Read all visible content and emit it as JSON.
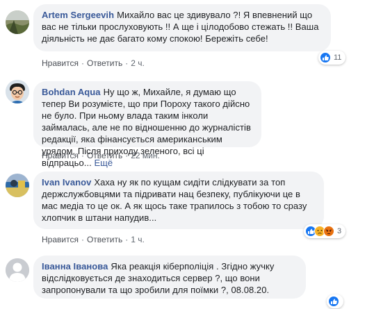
{
  "comments": [
    {
      "author": "Artem Sergeevih",
      "text": "Михайло вас це здивувало ?! Я впевнений що вас не тільки прослуховують !! А ще і цілодобово стежать !! Ваша діяльність не дає багато кому спокою! Бережіть себе!",
      "reaction_count": "11",
      "reactions": [
        "like-icon"
      ],
      "like_label": "Нравится",
      "reply_label": "Ответить",
      "time": "2 ч."
    },
    {
      "author": "Bohdan Aqua",
      "text": "Ну що ж, Михайле, я думаю що тепер Ви розумієте, що при Пороху такого дійсно не було. При ньому влада таким інколи займалась, але не по відношенню до журналістів редакції, яка фінансується американським урядом. Після приходу зеленого, всі ці відпрацьо...",
      "more": "Ещё",
      "like_label": "Нравится",
      "reply_label": "Ответить",
      "time": "22 мин."
    },
    {
      "author": "Ivan Ivanov",
      "text": "Хаха ну як по кущам сидіти слідкувати за топ держслужбовцями та підривати нац безпеку, публікуючи це в мас медіа то це ок. А як щось таке трапилось з тобою то сразу хлопчик в штани напудив...",
      "reaction_count": "3",
      "reactions": [
        "like-icon",
        "sad-icon",
        "angry-icon"
      ],
      "like_label": "Нравится",
      "reply_label": "Ответить",
      "time": "1 ч."
    },
    {
      "author": "Іванна Іванова",
      "text": "Яка реакція кіберполіція . Згідно жучку відслідковується де знаходиться сервер ?, що вони запропонували та що зробили для поїмки ?, 08.08.20.",
      "reaction_count": "",
      "reactions": [
        "like-icon"
      ]
    }
  ],
  "colors": {
    "link": "#385898",
    "bubble": "#f2f3f5",
    "like": "#1877f2",
    "sad": "#f7b125",
    "angry": "#e9710f"
  }
}
